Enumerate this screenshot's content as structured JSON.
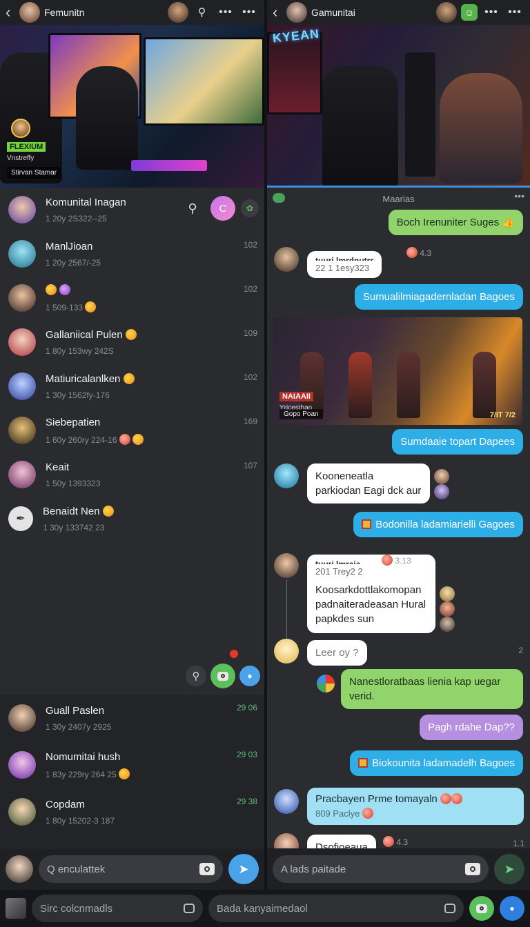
{
  "left": {
    "topbar": {
      "title": "Femunitn"
    },
    "hero": {
      "brand_tag": "FLEXIUM",
      "sub": "Vnstreffy",
      "chip": "Stirvan Stamar"
    },
    "conversations": [
      {
        "name": "Komunital Inagan",
        "sub": "1 20y 2S322--25",
        "count": ""
      },
      {
        "name": "ManlJioan",
        "sub": "1 20y 2567/-25",
        "count": "102"
      },
      {
        "name": "",
        "sub": "1 509-133",
        "count": "102"
      },
      {
        "name": "Gallaniical Pulen",
        "sub": "1 80y 153wy 242S",
        "count": "109"
      },
      {
        "name": "Matiuricalanlken",
        "sub": "1 30y 1562fy-176",
        "count": "102"
      },
      {
        "name": "Siebepatien",
        "sub": "1 60y 260ry 224-16",
        "count": "169"
      },
      {
        "name": "Keait",
        "sub": "1 50y 1393323",
        "count": "107"
      },
      {
        "name": "Benaidt Nen",
        "sub": "1 30y 133742 23",
        "count": ""
      }
    ],
    "lower_conversations": [
      {
        "name": "Guall Paslen",
        "sub": "1 30y 2407y 2925",
        "count": "29 06"
      },
      {
        "name": "Nomumitai hush",
        "sub": "1 83y 229ry 264 25",
        "count": "29 03"
      },
      {
        "name": "Copdam",
        "sub": "1 80y 15202-3 187",
        "count": "29 38"
      }
    ],
    "composer": {
      "placeholder": "Q enculattek"
    }
  },
  "right": {
    "topbar": {
      "title": "Gamunitai"
    },
    "hero": {
      "brand": "KYEAN"
    },
    "chat_title": "Maarias",
    "messages": [
      {
        "id": "m1",
        "text": "Boch Irenuniter Suges"
      },
      {
        "id": "m2_name",
        "text": "tuuri lmrdnutrr"
      },
      {
        "id": "m2",
        "text": "22 1 1esy323"
      },
      {
        "id": "m2_meta",
        "text": "4.3"
      },
      {
        "id": "m3",
        "text": "Sumualilmiagadernladan Bagoes"
      },
      {
        "id": "m4",
        "text": "Sumdaaie topart Dapees"
      },
      {
        "id": "m5",
        "text": "Kooneneatla parkiodan Eagi dck aur"
      },
      {
        "id": "m6",
        "text": "Bodonilla ladamiarielli Gagoes"
      },
      {
        "id": "m7_name",
        "text": "tuuri lmraia"
      },
      {
        "id": "m7_meta",
        "text": "3.13"
      },
      {
        "id": "m7_sub",
        "text": "201 Trey2 2"
      },
      {
        "id": "m7",
        "text": "Koosarkdottlakomopan padnaiteradeasan Hural papkdes sun"
      },
      {
        "id": "m8",
        "text": "Leer oy ?"
      },
      {
        "id": "m8_meta",
        "text": "2"
      },
      {
        "id": "m9",
        "text": "Nanestloratbaas lienia kap uegar verid."
      },
      {
        "id": "m10",
        "text": "Pagh rdahe Dap??"
      },
      {
        "id": "m11",
        "text": "Biokounita ladamadelh Bagoes"
      },
      {
        "id": "m12",
        "text": "Pracbayen Prme tomayaln"
      },
      {
        "id": "m12_sub",
        "text": "809 Paclye"
      },
      {
        "id": "m13_name",
        "text": "Dsofioeaua"
      },
      {
        "id": "m13_meta",
        "text": "4.3"
      },
      {
        "id": "m13_count",
        "text": "1.1"
      }
    ],
    "image_message": {
      "tag": "NAIAAII",
      "sub": "Yricesthan",
      "chip": "Gopo Poan",
      "code": "7/IT 7/2"
    },
    "composer": {
      "placeholder": "A lads paitade"
    }
  },
  "bottombar": {
    "left_placeholder": "Sirc colcnmadls",
    "right_placeholder": "Bada kanyaimedaol"
  },
  "colors": {
    "accent_blue": "#2eaee6",
    "accent_green": "#91d46c",
    "accent_purple": "#b78fe0",
    "send_blue": "#4aa3e8",
    "camera_green": "#5bbf5b"
  }
}
